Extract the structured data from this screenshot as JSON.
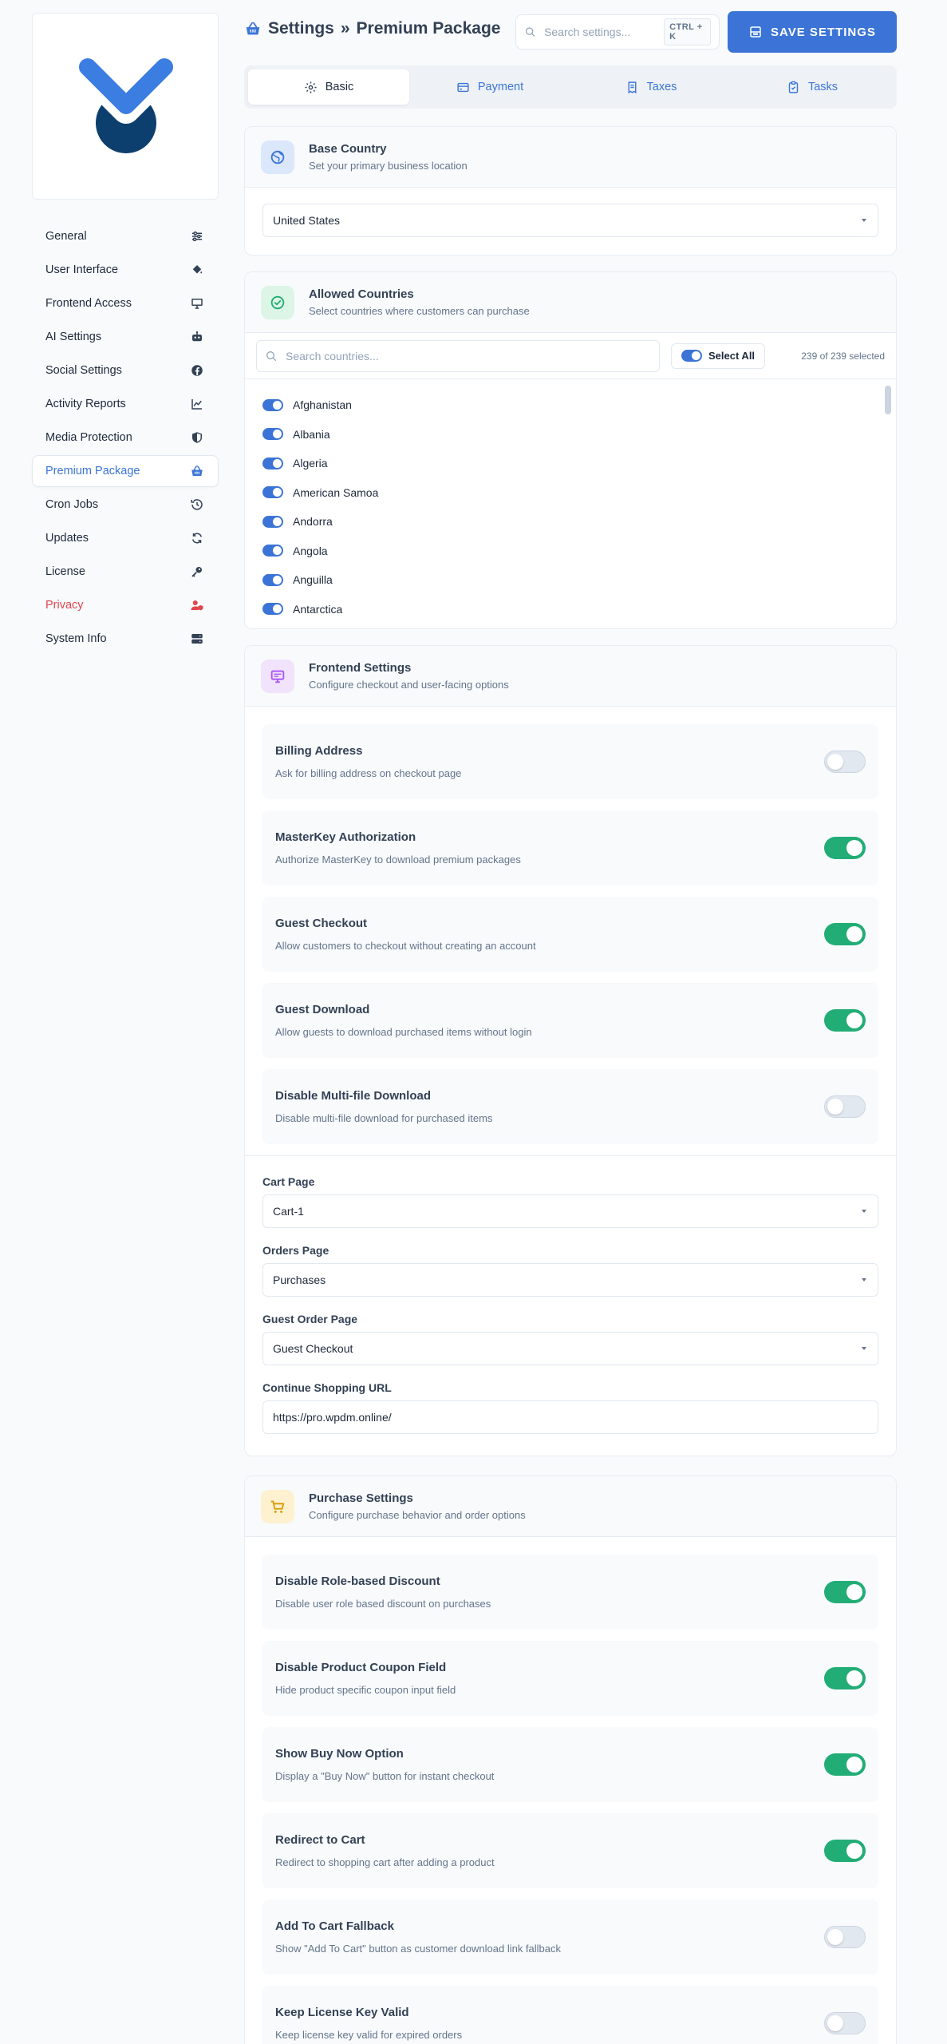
{
  "header": {
    "title_part1": "Settings",
    "separator": "»",
    "title_part2": "Premium Package",
    "search_placeholder": "Search settings...",
    "shortcut": "CTRL + K",
    "save_label": "SAVE SETTINGS"
  },
  "colors": {
    "accent": "#3b74d6",
    "toggle_on": "#22ad76",
    "danger": "#e0454c",
    "logo_light": "#3b7de0",
    "logo_dark": "#0c3f6e"
  },
  "sidebar": {
    "items": [
      {
        "label": "General",
        "icon": "sliders-icon",
        "active": false
      },
      {
        "label": "User Interface",
        "icon": "paint-bucket-icon",
        "active": false
      },
      {
        "label": "Frontend Access",
        "icon": "monitor-icon",
        "active": false
      },
      {
        "label": "AI Settings",
        "icon": "robot-icon",
        "active": false
      },
      {
        "label": "Social Settings",
        "icon": "facebook-icon",
        "active": false
      },
      {
        "label": "Activity Reports",
        "icon": "chart-line-icon",
        "active": false
      },
      {
        "label": "Media Protection",
        "icon": "shield-icon",
        "active": false
      },
      {
        "label": "Premium Package",
        "icon": "basket-icon",
        "active": true
      },
      {
        "label": "Cron Jobs",
        "icon": "history-icon",
        "active": false
      },
      {
        "label": "Updates",
        "icon": "refresh-icon",
        "active": false
      },
      {
        "label": "License",
        "icon": "key-icon",
        "active": false
      },
      {
        "label": "Privacy",
        "icon": "user-shield-icon",
        "active": false
      },
      {
        "label": "System Info",
        "icon": "server-icon",
        "active": false
      }
    ]
  },
  "tabs": [
    {
      "label": "Basic",
      "icon": "gear-icon",
      "active": true
    },
    {
      "label": "Payment",
      "icon": "credit-card-icon",
      "active": false
    },
    {
      "label": "Taxes",
      "icon": "receipt-icon",
      "active": false
    },
    {
      "label": "Tasks",
      "icon": "clipboard-check-icon",
      "active": false
    }
  ],
  "base_country": {
    "title": "Base Country",
    "subtitle": "Set your primary business location",
    "value": "United States"
  },
  "allowed_countries": {
    "title": "Allowed Countries",
    "subtitle": "Select countries where customers can purchase",
    "search_placeholder": "Search countries...",
    "select_all_label": "Select All",
    "count_text": "239 of 239 selected",
    "countries": [
      "Afghanistan",
      "Albania",
      "Algeria",
      "American Samoa",
      "Andorra",
      "Angola",
      "Anguilla",
      "Antarctica"
    ]
  },
  "frontend": {
    "title": "Frontend Settings",
    "subtitle": "Configure checkout and user-facing options",
    "settings": [
      {
        "title": "Billing Address",
        "desc": "Ask for billing address on checkout page",
        "on": false
      },
      {
        "title": "MasterKey Authorization",
        "desc": "Authorize MasterKey to download premium packages",
        "on": true
      },
      {
        "title": "Guest Checkout",
        "desc": "Allow customers to checkout without creating an account",
        "on": true
      },
      {
        "title": "Guest Download",
        "desc": "Allow guests to download purchased items without login",
        "on": true
      },
      {
        "title": "Disable Multi-file Download",
        "desc": "Disable multi-file download for purchased items",
        "on": false
      }
    ],
    "cart_page_label": "Cart Page",
    "cart_page_value": "Cart-1",
    "orders_page_label": "Orders Page",
    "orders_page_value": "Purchases",
    "guest_order_label": "Guest Order Page",
    "guest_order_value": "Guest Checkout",
    "continue_url_label": "Continue Shopping URL",
    "continue_url_value": "https://pro.wpdm.online/"
  },
  "purchase": {
    "title": "Purchase Settings",
    "subtitle": "Configure purchase behavior and order options",
    "settings": [
      {
        "title": "Disable Role-based Discount",
        "desc": "Disable user role based discount on purchases",
        "on": true
      },
      {
        "title": "Disable Product Coupon Field",
        "desc": "Hide product specific coupon input field",
        "on": true
      },
      {
        "title": "Show Buy Now Option",
        "desc": "Display a \"Buy Now\" button for instant checkout",
        "on": true
      },
      {
        "title": "Redirect to Cart",
        "desc": "Redirect to shopping cart after adding a product",
        "on": true
      },
      {
        "title": "Add To Cart Fallback",
        "desc": "Show \"Add To Cart\" button as customer download link fallback",
        "on": false
      },
      {
        "title": "Keep License Key Valid",
        "desc": "Keep license key valid for expired orders",
        "on": false
      }
    ]
  }
}
